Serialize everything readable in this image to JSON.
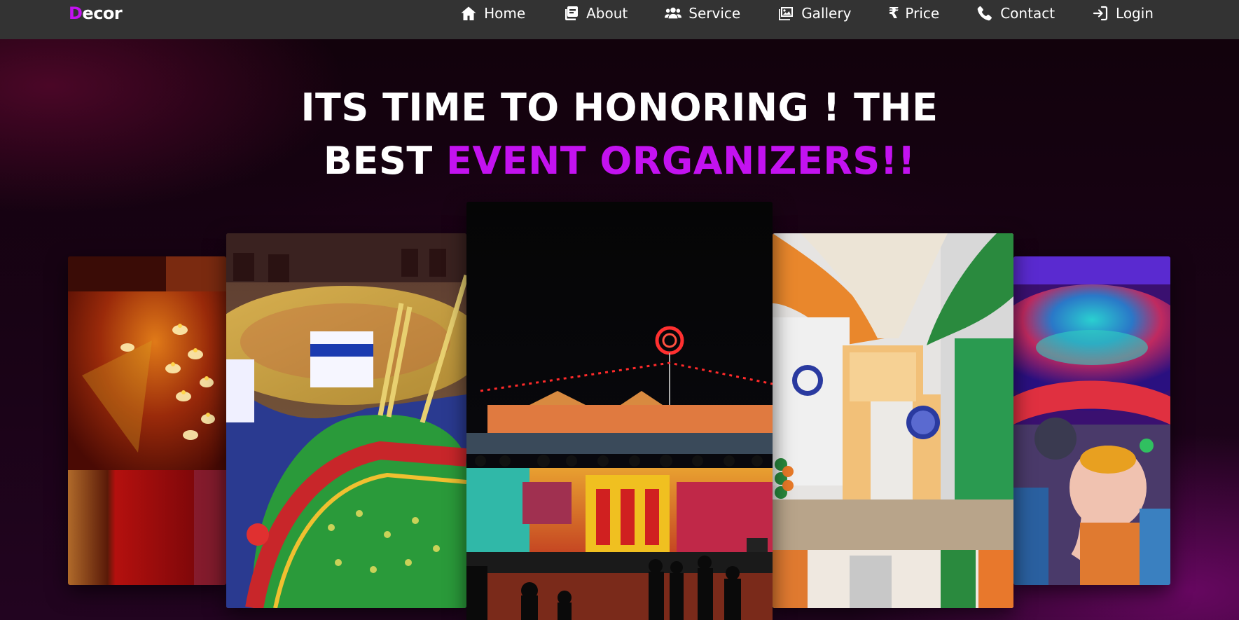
{
  "brand": {
    "first_letter": "D",
    "rest": "ecor"
  },
  "nav": {
    "items": [
      {
        "label": "Home",
        "icon": "home-icon"
      },
      {
        "label": "About",
        "icon": "about-icon"
      },
      {
        "label": "Service",
        "icon": "users-icon"
      },
      {
        "label": "Gallery",
        "icon": "images-icon"
      },
      {
        "label": "Price",
        "icon": "rupee-icon",
        "glyph": "₹"
      },
      {
        "label": "Contact",
        "icon": "phone-icon"
      },
      {
        "label": "Login",
        "icon": "login-icon"
      }
    ]
  },
  "hero": {
    "line1": "ITS TIME TO HONORING ! THE",
    "line2_plain": "BEST ",
    "line2_accent": "EVENT ORGANIZERS!!"
  },
  "gallery": {
    "images": [
      {
        "name": "diya-candles-decor-image"
      },
      {
        "name": "navratri-garba-decor-image"
      },
      {
        "name": "stage-lighting-event-image"
      },
      {
        "name": "india-gate-tricolor-decor-image"
      },
      {
        "name": "ganesh-idol-decor-image"
      }
    ]
  },
  "colors": {
    "accent": "#c312f0",
    "navbar": "#333333",
    "hero_background": "#14020f"
  }
}
